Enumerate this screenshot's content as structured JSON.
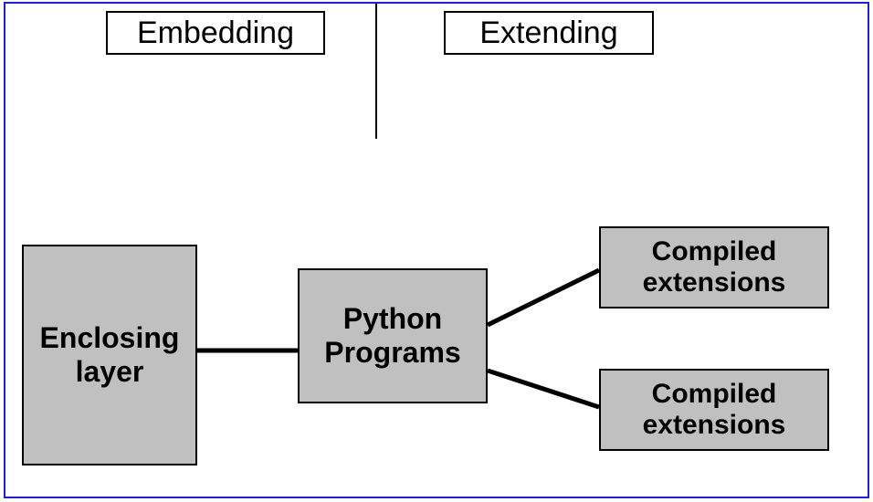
{
  "headers": {
    "left": "Embedding",
    "right": "Extending"
  },
  "nodes": {
    "enclosing": "Enclosing\nlayer",
    "python": "Python\nPrograms",
    "ext1": "Compiled\nextensions",
    "ext2": "Compiled\nextensions"
  }
}
